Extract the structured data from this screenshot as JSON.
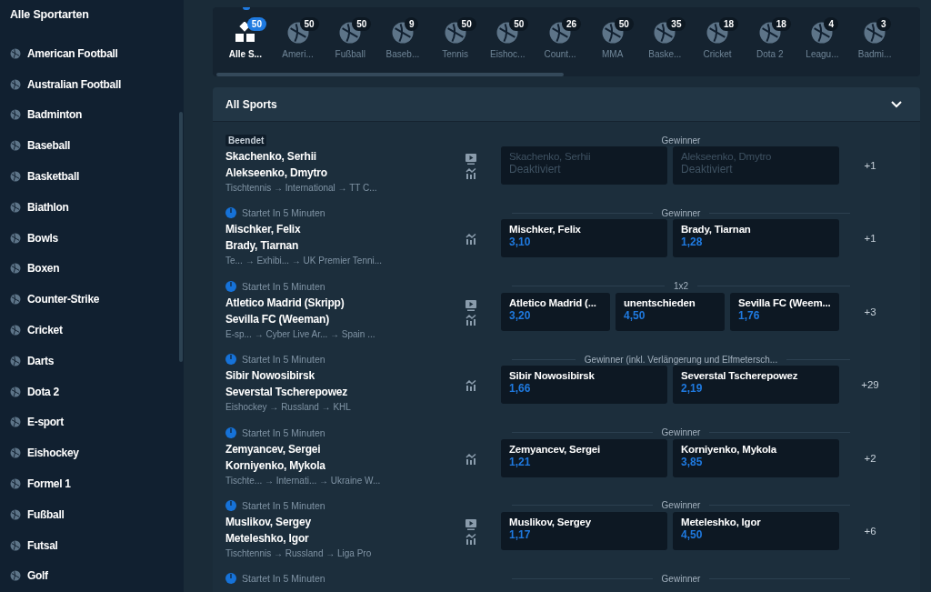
{
  "sidebar": {
    "title": "Alle Sportarten",
    "items": [
      {
        "label": "American Football"
      },
      {
        "label": "Australian Football"
      },
      {
        "label": "Badminton"
      },
      {
        "label": "Baseball"
      },
      {
        "label": "Basketball"
      },
      {
        "label": "Biathlon"
      },
      {
        "label": "Bowls"
      },
      {
        "label": "Boxen"
      },
      {
        "label": "Counter-Strike"
      },
      {
        "label": "Cricket"
      },
      {
        "label": "Darts"
      },
      {
        "label": "Dota 2"
      },
      {
        "label": "E-sport"
      },
      {
        "label": "Eishockey"
      },
      {
        "label": "Formel 1"
      },
      {
        "label": "Fußball"
      },
      {
        "label": "Futsal"
      },
      {
        "label": "Golf"
      }
    ]
  },
  "sport_tabs": [
    {
      "label": "Alle S...",
      "count": "50",
      "selected": true
    },
    {
      "label": "Ameri...",
      "count": "50",
      "selected": false
    },
    {
      "label": "Fußball",
      "count": "50",
      "selected": false
    },
    {
      "label": "Baseb...",
      "count": "9",
      "selected": false
    },
    {
      "label": "Tennis",
      "count": "50",
      "selected": false
    },
    {
      "label": "Eishoc...",
      "count": "50",
      "selected": false
    },
    {
      "label": "Count...",
      "count": "26",
      "selected": false
    },
    {
      "label": "MMA",
      "count": "50",
      "selected": false
    },
    {
      "label": "Baske...",
      "count": "35",
      "selected": false
    },
    {
      "label": "Cricket",
      "count": "18",
      "selected": false
    },
    {
      "label": "Dota 2",
      "count": "18",
      "selected": false
    },
    {
      "label": "Leagu...",
      "count": "4",
      "selected": false
    },
    {
      "label": "Badmi...",
      "count": "3",
      "selected": false
    }
  ],
  "panel": {
    "title": "All Sports",
    "expanded": true,
    "events": [
      {
        "kind": "finished",
        "status": "Beendet",
        "home": "Skachenko, Serhii",
        "away": "Alekseenko, Dmytro",
        "path": "Tischtennis → International → TT C...",
        "video": true,
        "market": "Gewinner",
        "outcomes": [
          {
            "label": "Skachenko, Serhii",
            "odds": "Deaktiviert",
            "disabled": true
          },
          {
            "label": "Alekseenko, Dmytro",
            "odds": "Deaktiviert",
            "disabled": true
          }
        ],
        "more": "+1"
      },
      {
        "kind": "upcoming",
        "status": "Startet In 5 Minuten",
        "home": "Mischker, Felix",
        "away": "Brady, Tiarnan",
        "path": "Te...  → Exhibi... → UK Premier Tenni...",
        "video": false,
        "market": "Gewinner",
        "outcomes": [
          {
            "label": "Mischker, Felix",
            "odds": "3,10",
            "disabled": false
          },
          {
            "label": "Brady, Tiarnan",
            "odds": "1,28",
            "disabled": false
          }
        ],
        "more": "+1"
      },
      {
        "kind": "upcoming",
        "status": "Startet In 5 Minuten",
        "home": "Atletico Madrid (Skripp)",
        "away": "Sevilla FC (Weeman)",
        "path": "E-sp...  → Cyber Live Ar...  → Spain ...",
        "video": true,
        "market": "1x2",
        "outcomes": [
          {
            "label": "Atletico Madrid (...",
            "odds": "3,20",
            "disabled": false
          },
          {
            "label": "unentschieden",
            "odds": "4,50",
            "disabled": false
          },
          {
            "label": "Sevilla FC (Weem...",
            "odds": "1,76",
            "disabled": false
          }
        ],
        "more": "+3"
      },
      {
        "kind": "upcoming",
        "status": "Startet In 5 Minuten",
        "home": "Sibir Nowosibirsk",
        "away": "Severstal Tscherepowez",
        "path": "Eishockey → Russland → KHL",
        "video": false,
        "market": "Gewinner (inkl. Verlängerung und Elfmetersch...",
        "outcomes": [
          {
            "label": "Sibir Nowosibirsk",
            "odds": "1,66",
            "disabled": false
          },
          {
            "label": "Severstal Tscherepowez",
            "odds": "2,19",
            "disabled": false
          }
        ],
        "more": "+29"
      },
      {
        "kind": "upcoming",
        "status": "Startet In 5 Minuten",
        "home": "Zemyancev, Sergei",
        "away": "Korniyenko, Mykola",
        "path": "Tischte... → Internati...  → Ukraine W...",
        "video": false,
        "market": "Gewinner",
        "outcomes": [
          {
            "label": "Zemyancev, Sergei",
            "odds": "1,21",
            "disabled": false
          },
          {
            "label": "Korniyenko, Mykola",
            "odds": "3,85",
            "disabled": false
          }
        ],
        "more": "+2"
      },
      {
        "kind": "upcoming",
        "status": "Startet In 5 Minuten",
        "home": "Muslikov, Sergey",
        "away": "Meteleshko, Igor",
        "path": "Tischtennis → Russland → Liga Pro",
        "video": true,
        "market": "Gewinner",
        "outcomes": [
          {
            "label": "Muslikov, Sergey",
            "odds": "1,17",
            "disabled": false
          },
          {
            "label": "Meteleshko, Igor",
            "odds": "4,50",
            "disabled": false
          }
        ],
        "more": "+6"
      },
      {
        "kind": "upcoming",
        "status": "Startet In 5 Minuten",
        "market": "Gewinner"
      }
    ]
  }
}
